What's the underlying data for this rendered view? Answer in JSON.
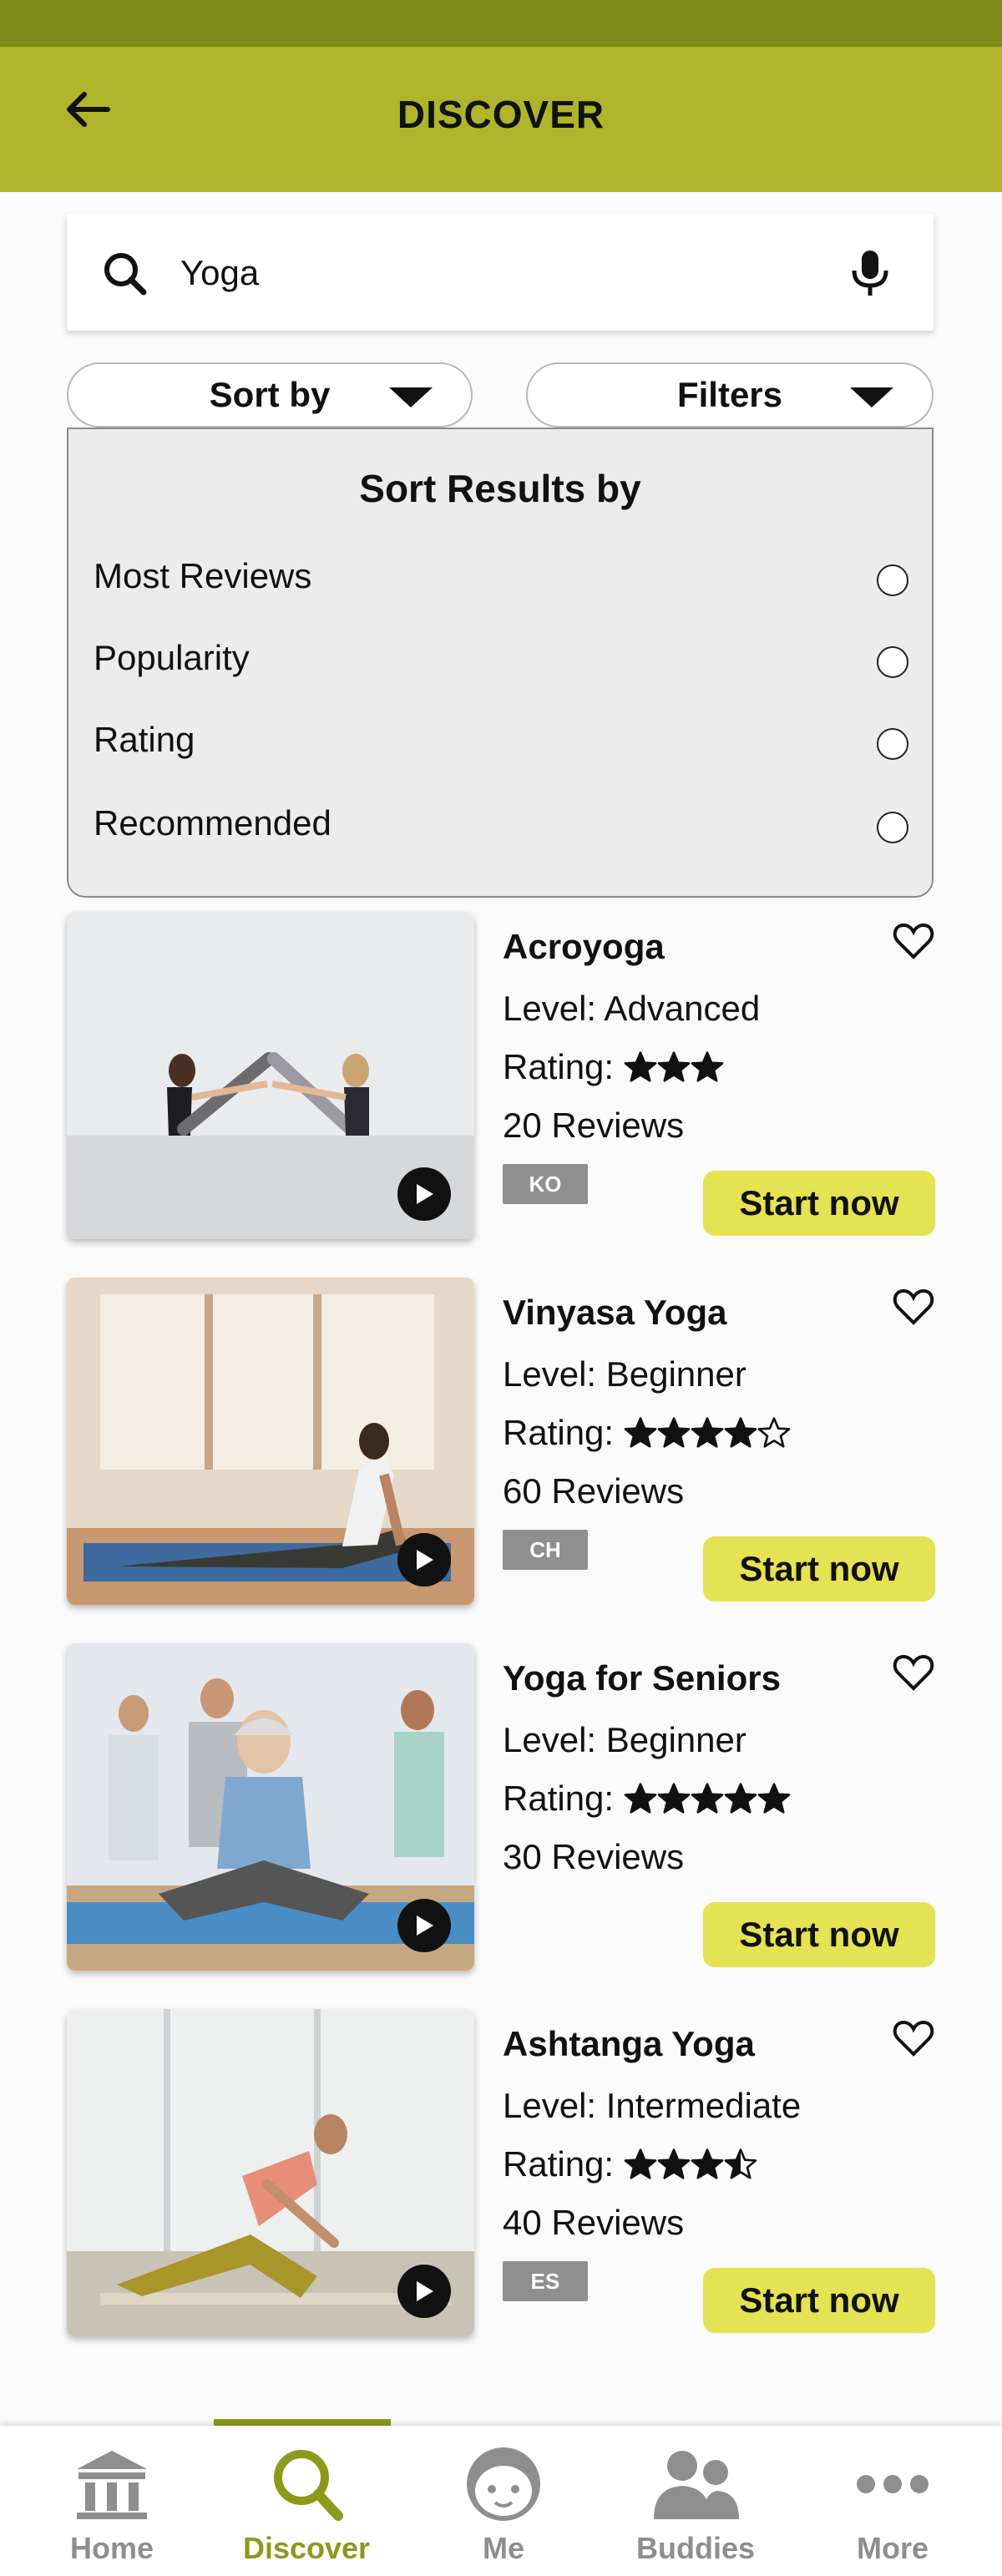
{
  "header": {
    "title": "DISCOVER",
    "back_icon": "arrow-left-icon"
  },
  "search": {
    "value": "Yoga",
    "placeholder": "Search"
  },
  "controls": {
    "sort_label": "Sort by",
    "filters_label": "Filters"
  },
  "sort_panel": {
    "title": "Sort Results by",
    "options": [
      {
        "label": "Most Reviews",
        "selected": false
      },
      {
        "label": "Popularity",
        "selected": false
      },
      {
        "label": "Rating",
        "selected": false
      },
      {
        "label": "Recommended",
        "selected": false
      }
    ]
  },
  "results": [
    {
      "title": "Acroyoga",
      "level": "Level: Advanced",
      "rating_label": "Rating:",
      "rating": 3,
      "max_rating": 3,
      "reviews": "20 Reviews",
      "language": "KO",
      "cta": "Start now"
    },
    {
      "title": "Vinyasa Yoga",
      "level": "Level: Beginner",
      "rating_label": "Rating:",
      "rating": 4,
      "max_rating": 5,
      "reviews": "60 Reviews",
      "language": "CH",
      "cta": "Start now"
    },
    {
      "title": "Yoga for Seniors",
      "level": "Level: Beginner",
      "rating_label": "Rating:",
      "rating": 5,
      "max_rating": 5,
      "reviews": "30 Reviews",
      "language": "",
      "cta": "Start now"
    },
    {
      "title": "Ashtanga Yoga",
      "level": "Level: Intermediate",
      "rating_label": "Rating:",
      "rating": 3.5,
      "max_rating": 4,
      "reviews": "40 Reviews",
      "language": "ES",
      "cta": "Start now"
    }
  ],
  "bottom_nav": [
    {
      "label": "Home",
      "icon": "home-icon",
      "active": false
    },
    {
      "label": "Discover",
      "icon": "search-icon",
      "active": true
    },
    {
      "label": "Me",
      "icon": "face-icon",
      "active": false
    },
    {
      "label": "Buddies",
      "icon": "people-icon",
      "active": false
    },
    {
      "label": "More",
      "icon": "more-icon",
      "active": false
    }
  ],
  "colors": {
    "status_bar": "#7c8a18",
    "app_bar": "#aeb52a",
    "accent": "#8c9a1c",
    "cta": "#e3e353",
    "badge": "#8f8f8f"
  }
}
